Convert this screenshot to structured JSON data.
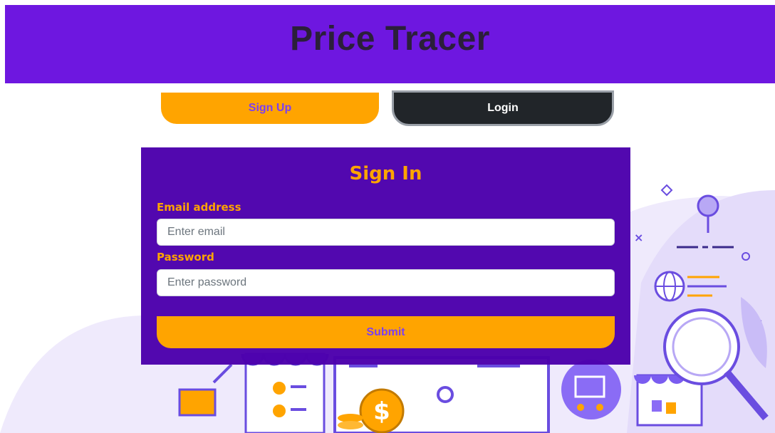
{
  "header": {
    "title": "Price Tracer"
  },
  "tabs": {
    "signup_label": "Sign Up",
    "login_label": "Login"
  },
  "form": {
    "title": "Sign In",
    "email_label": "Email address",
    "email_placeholder": "Enter email",
    "password_label": "Password",
    "password_placeholder": "Enter password",
    "submit_label": "Submit"
  },
  "colors": {
    "header_bg": "#6e17e0",
    "accent_orange": "#ffa400",
    "form_bg": "#4c00ac",
    "login_tab_bg": "#212529",
    "button_text_purple": "#7b3ff2"
  },
  "icons": [
    "shopping-cart-icon",
    "globe-icon",
    "magnifier-icon",
    "dollar-coin-icon",
    "storefront-icon",
    "map-pin-icon"
  ]
}
